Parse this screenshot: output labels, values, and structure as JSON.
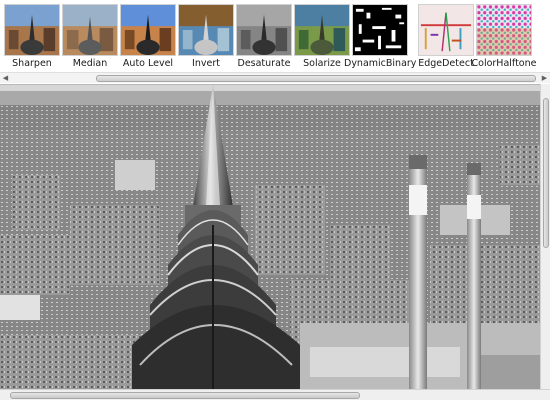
{
  "filters": [
    {
      "id": "sharpen",
      "label": "Sharpen",
      "icon": "sharpen-preview"
    },
    {
      "id": "median",
      "label": "Median",
      "icon": "median-preview"
    },
    {
      "id": "auto-level",
      "label": "Auto Level",
      "icon": "auto-level-preview"
    },
    {
      "id": "invert",
      "label": "Invert",
      "icon": "invert-preview"
    },
    {
      "id": "desaturate",
      "label": "Desaturate",
      "icon": "desaturate-preview"
    },
    {
      "id": "solarize",
      "label": "Solarize",
      "icon": "solarize-preview"
    },
    {
      "id": "dynamic-binary",
      "label": "DynamicBinary",
      "icon": "dynamic-binary-preview"
    },
    {
      "id": "edge-detect",
      "label": "EdgeDetect",
      "icon": "edge-detect-preview"
    },
    {
      "id": "color-halftone",
      "label": "ColorHalftone",
      "icon": "color-halftone-preview"
    }
  ],
  "image": {
    "subject": "grayscale city skyline with a tower spire and two smokestacks"
  },
  "colors": {
    "scrollbar_track": "#efefef",
    "scrollbar_thumb": "#cacaca"
  }
}
